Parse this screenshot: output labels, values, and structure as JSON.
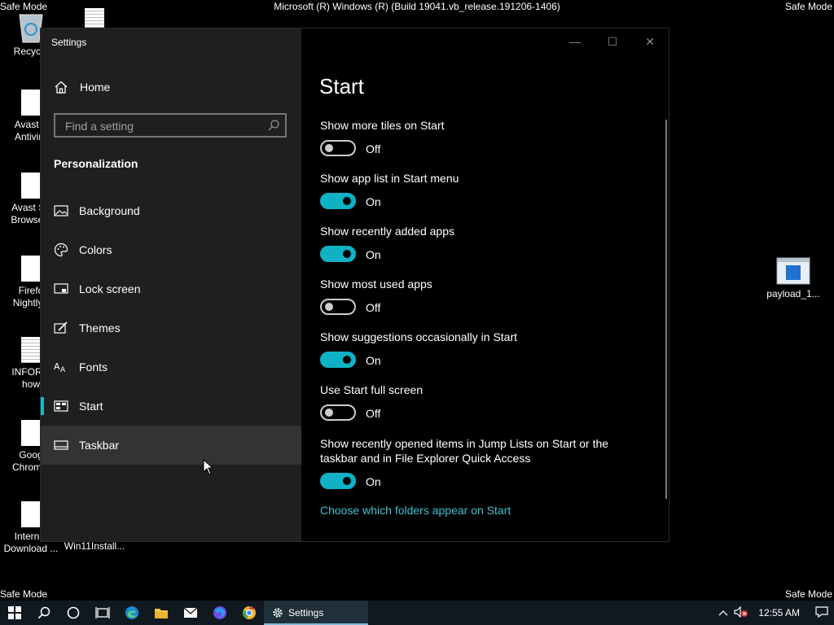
{
  "desktop": {
    "safe_mode_label": "Safe Mode",
    "build_string": "Microsoft (R) Windows (R) (Build 19041.vb_release.191206-1406)",
    "icons": [
      {
        "label": "Recycle"
      },
      {
        "label": "Avast F\nAntiviru"
      },
      {
        "label": "Avast Se\nBrowser.l"
      },
      {
        "label": "Firefo\nNightly.li"
      },
      {
        "label": "INFORM\nhow"
      },
      {
        "label": "Goog\nChrome."
      },
      {
        "label": "Internet\nDownload ..."
      },
      {
        "label": "Win11Install..."
      },
      {
        "label": "payload_1..."
      }
    ]
  },
  "window": {
    "title": "Settings",
    "controls": {
      "minimize": "—",
      "maximize": "☐",
      "close": "✕"
    }
  },
  "sidebar": {
    "home_label": "Home",
    "search_placeholder": "Find a setting",
    "section_title": "Personalization",
    "items": [
      {
        "label": "Background",
        "icon": "image-icon"
      },
      {
        "label": "Colors",
        "icon": "palette-icon"
      },
      {
        "label": "Lock screen",
        "icon": "lock-screen-icon"
      },
      {
        "label": "Themes",
        "icon": "themes-icon"
      },
      {
        "label": "Fonts",
        "icon": "fonts-icon"
      },
      {
        "label": "Start",
        "icon": "start-icon",
        "selected": true
      },
      {
        "label": "Taskbar",
        "icon": "taskbar-icon",
        "hovered": true
      }
    ]
  },
  "main": {
    "title": "Start",
    "options": [
      {
        "label": "Show more tiles on Start",
        "on": false,
        "state": "Off"
      },
      {
        "label": "Show app list in Start menu",
        "on": true,
        "state": "On"
      },
      {
        "label": "Show recently added apps",
        "on": true,
        "state": "On"
      },
      {
        "label": "Show most used apps",
        "on": false,
        "state": "Off"
      },
      {
        "label": "Show suggestions occasionally in Start",
        "on": true,
        "state": "On"
      },
      {
        "label": "Use Start full screen",
        "on": false,
        "state": "Off"
      },
      {
        "label": "Show recently opened items in Jump Lists on Start or the taskbar and in File Explorer Quick Access",
        "on": true,
        "state": "On"
      }
    ],
    "link_text": "Choose which folders appear on Start"
  },
  "taskbar": {
    "settings_label": "Settings",
    "clock": "12:55 AM",
    "colors": {
      "background": "#101820",
      "accent": "#0fb2c5"
    }
  }
}
